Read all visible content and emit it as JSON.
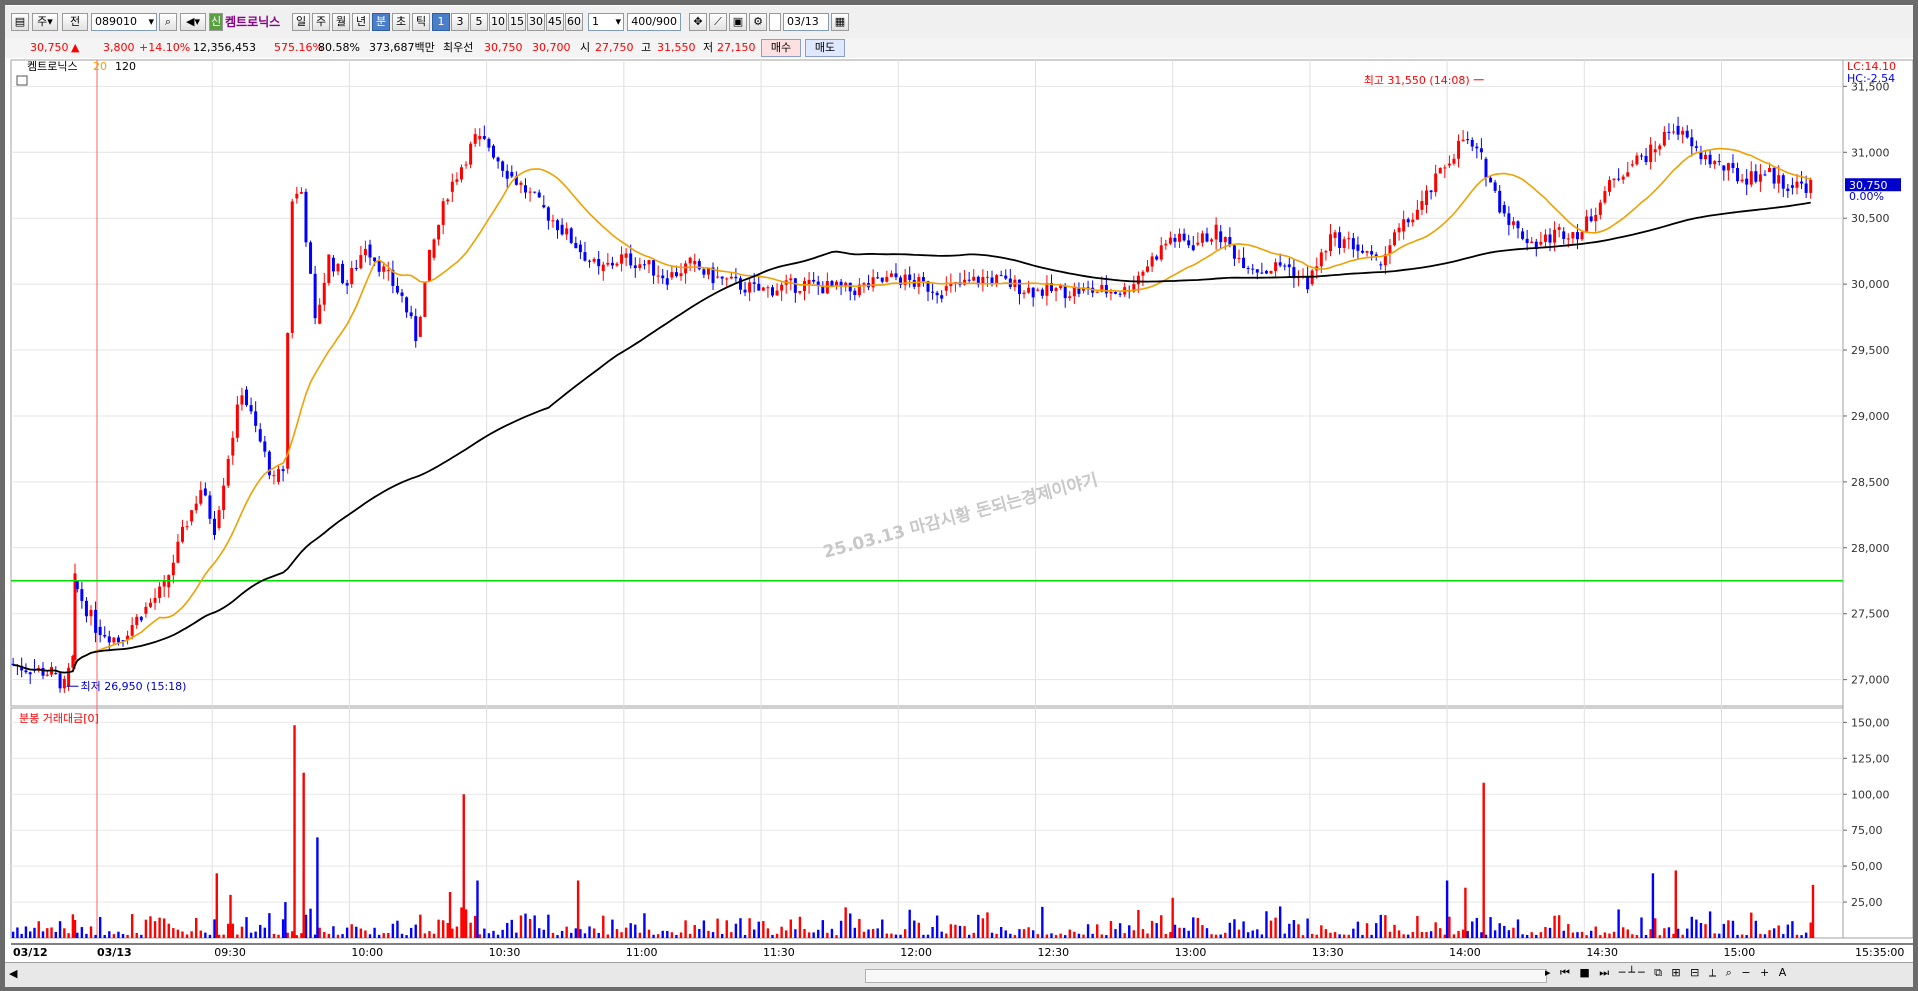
{
  "toolbar": {
    "market_select": "주",
    "prev_label": "전",
    "stock_code": "089010",
    "stock_name": "켐트로닉스",
    "period_buttons": [
      "일",
      "주",
      "월",
      "년",
      "분",
      "초",
      "틱"
    ],
    "interval_buttons": [
      "1",
      "3",
      "5",
      "10",
      "15",
      "30",
      "45",
      "60"
    ],
    "interval_value": "1",
    "count_display": "400/900",
    "date_value": "03/13"
  },
  "quote": {
    "price": "30,750",
    "change": "3,800",
    "change_pct": "+14.10%",
    "volume": "12,356,453",
    "volume_ratio": "575.16%",
    "turnover": "80.58%",
    "amount": "373,687백만",
    "best_label": "최우선",
    "best_ask": "30,750",
    "best_bid": "30,700",
    "open_label": "시",
    "open": "27,750",
    "high_label": "고",
    "high": "31,550",
    "low_label": "저",
    "low": "27,150",
    "buy_label": "매수",
    "sell_label": "매도"
  },
  "price_panel": {
    "legend_name": "켐트로닉스",
    "ma_short": "20",
    "ma_long": "120",
    "lc_label": "LC:14.10",
    "hc_label": "HC:-2.54",
    "current_tag": "30,750",
    "current_pct": "0.00%",
    "max_annotation": "최고 31,550 (14:08)",
    "min_annotation": "최저 26,950 (15:18)",
    "watermark": "25.03.13 마감시황 돈되는경제이야기",
    "colors": {
      "up": "#ff0000",
      "down": "#0000ff",
      "ma20": "#f0a000",
      "ma120": "#000000",
      "hline": "#00e000"
    }
  },
  "volume_panel": {
    "legend": "분봉 거래대금[0]"
  },
  "x_axis": {
    "start_label": "03/12",
    "day_label": "03/13",
    "end_label": "15:35:00"
  },
  "chart_data": {
    "type": "candlestick",
    "price_axis": {
      "ticks": [
        "31,500",
        "31,000",
        "30,500",
        "30,000",
        "29,500",
        "29,000",
        "28,500",
        "28,000",
        "27,500",
        "27,000"
      ],
      "ylim": [
        26800,
        31700
      ]
    },
    "volume_axis": {
      "ticks": [
        "150,00",
        "125,00",
        "100,00",
        "75,00",
        "50,00",
        "25,00"
      ],
      "ylim": [
        0,
        160
      ]
    },
    "time_ticks": [
      "09:30",
      "10:00",
      "10:30",
      "11:00",
      "11:30",
      "12:00",
      "12:30",
      "13:00",
      "13:30",
      "14:00",
      "14:30",
      "15:00"
    ],
    "horizontal_line": 27750,
    "close_series": [
      [
        "15:05",
        27120
      ],
      [
        "15:10",
        27080
      ],
      [
        "15:15",
        27050
      ],
      [
        "15:18",
        26950
      ],
      [
        "15:20",
        27150
      ],
      [
        "09:00",
        27750
      ],
      [
        "09:05",
        27400
      ],
      [
        "09:10",
        27300
      ],
      [
        "09:15",
        27500
      ],
      [
        "09:20",
        27700
      ],
      [
        "09:25",
        28200
      ],
      [
        "09:28",
        28450
      ],
      [
        "09:31",
        28150
      ],
      [
        "09:34",
        28700
      ],
      [
        "09:37",
        29200
      ],
      [
        "09:40",
        28900
      ],
      [
        "09:44",
        28500
      ],
      [
        "09:46",
        28600
      ],
      [
        "09:48",
        30650
      ],
      [
        "09:50",
        30700
      ],
      [
        "09:53",
        29700
      ],
      [
        "09:56",
        30200
      ],
      [
        "10:00",
        30000
      ],
      [
        "10:04",
        30300
      ],
      [
        "10:08",
        30100
      ],
      [
        "10:12",
        29900
      ],
      [
        "10:15",
        29600
      ],
      [
        "10:18",
        30200
      ],
      [
        "10:22",
        30700
      ],
      [
        "10:25",
        30900
      ],
      [
        "10:28",
        31100
      ],
      [
        "10:31",
        31050
      ],
      [
        "10:35",
        30850
      ],
      [
        "10:38",
        30750
      ],
      [
        "10:42",
        30600
      ],
      [
        "10:46",
        30450
      ],
      [
        "10:50",
        30300
      ],
      [
        "10:55",
        30100
      ],
      [
        "11:00",
        30200
      ],
      [
        "11:05",
        30150
      ],
      [
        "11:10",
        30050
      ],
      [
        "11:15",
        30150
      ],
      [
        "11:20",
        30050
      ],
      [
        "11:30",
        29950
      ],
      [
        "11:40",
        30000
      ],
      [
        "11:50",
        29950
      ],
      [
        "12:00",
        30050
      ],
      [
        "12:10",
        29950
      ],
      [
        "12:20",
        30050
      ],
      [
        "12:30",
        29950
      ],
      [
        "12:40",
        29950
      ],
      [
        "12:50",
        29950
      ],
      [
        "13:00",
        30350
      ],
      [
        "13:05",
        30300
      ],
      [
        "13:10",
        30400
      ],
      [
        "13:15",
        30200
      ],
      [
        "13:20",
        30100
      ],
      [
        "13:25",
        30150
      ],
      [
        "13:30",
        30000
      ],
      [
        "13:35",
        30350
      ],
      [
        "13:40",
        30300
      ],
      [
        "13:45",
        30150
      ],
      [
        "13:50",
        30400
      ],
      [
        "13:55",
        30600
      ],
      [
        "14:00",
        30900
      ],
      [
        "14:04",
        31100
      ],
      [
        "14:08",
        30950
      ],
      [
        "14:12",
        30600
      ],
      [
        "14:16",
        30400
      ],
      [
        "14:20",
        30300
      ],
      [
        "14:25",
        30400
      ],
      [
        "14:30",
        30400
      ],
      [
        "14:35",
        30700
      ],
      [
        "14:40",
        30900
      ],
      [
        "14:45",
        31000
      ],
      [
        "14:50",
        31200
      ],
      [
        "14:55",
        31000
      ],
      [
        "15:00",
        30900
      ],
      [
        "15:05",
        30800
      ],
      [
        "15:10",
        30850
      ],
      [
        "15:15",
        30750
      ],
      [
        "15:20",
        30750
      ]
    ],
    "ma20_label": "20",
    "ma120_label": "120"
  }
}
